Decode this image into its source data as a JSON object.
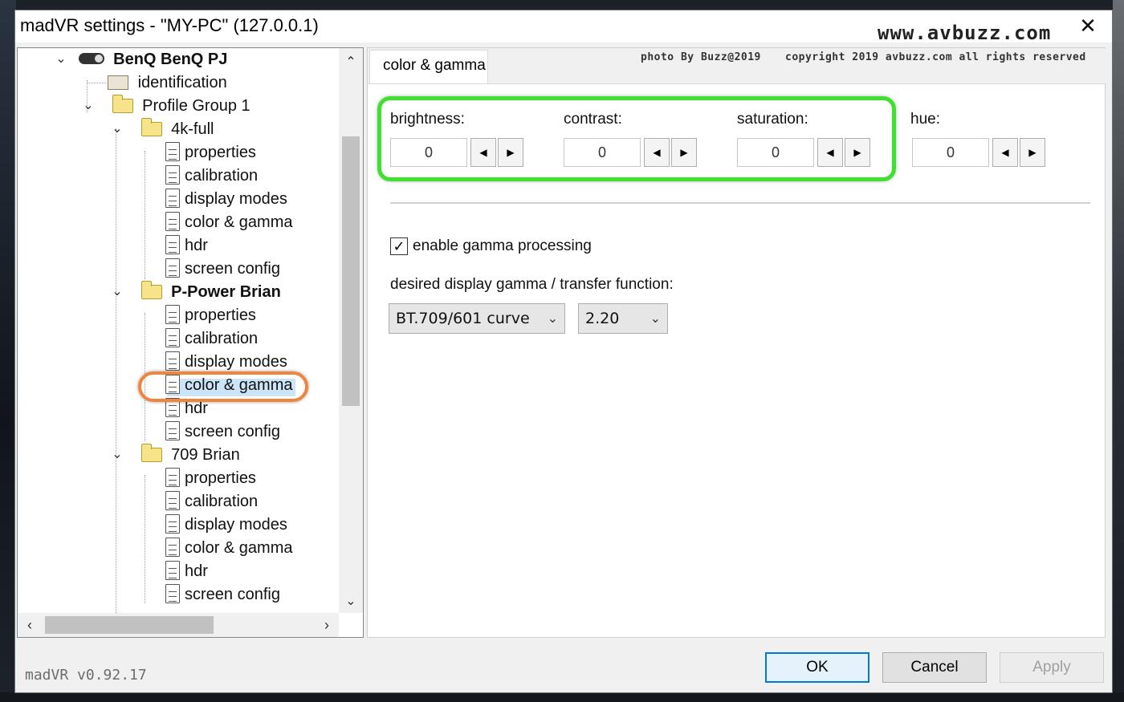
{
  "window": {
    "title": "madVR settings - \"MY-PC\" (127.0.0.1)",
    "watermark": "www.avbuzz.com",
    "close_glyph": "✕"
  },
  "tree": {
    "root": "BenQ BenQ PJ",
    "identification": "identification",
    "profile_group": "Profile Group 1",
    "groups": [
      {
        "name": "4k-full",
        "items": [
          "properties",
          "calibration",
          "display modes",
          "color & gamma",
          "hdr",
          "screen config"
        ]
      },
      {
        "name": "P-Power Brian",
        "items": [
          "properties",
          "calibration",
          "display modes",
          "color & gamma",
          "hdr",
          "screen config"
        ]
      },
      {
        "name": "709 Brian",
        "items": [
          "properties",
          "calibration",
          "display modes",
          "color & gamma",
          "hdr",
          "screen config"
        ]
      }
    ]
  },
  "tab": {
    "label": "color & gamma"
  },
  "credits": {
    "photo": "photo By Buzz@2019",
    "copyright": "copyright 2019 avbuzz.com all rights reserved"
  },
  "adjustments": {
    "brightness": {
      "label": "brightness:",
      "value": "0"
    },
    "contrast": {
      "label": "contrast:",
      "value": "0"
    },
    "saturation": {
      "label": "saturation:",
      "value": "0"
    },
    "hue": {
      "label": "hue:",
      "value": "0"
    }
  },
  "gamma": {
    "checkbox_label": "enable gamma processing",
    "checkbox_checked": true,
    "transfer_label": "desired display gamma / transfer function:",
    "curve_value": "BT.709/601 curve",
    "gamma_value": "2.20"
  },
  "footer": {
    "version": "madVR v0.92.17",
    "ok": "OK",
    "cancel": "Cancel",
    "apply": "Apply"
  },
  "colors": {
    "green_highlight": "#3ee22e",
    "orange_highlight": "#f0843c",
    "selection": "#cce4f7"
  }
}
